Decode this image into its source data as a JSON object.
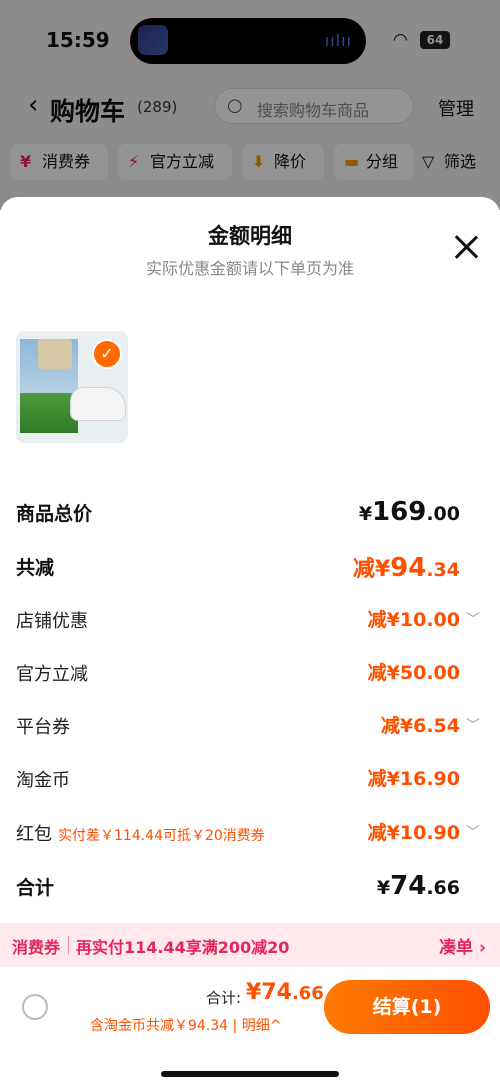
{
  "status_bar": {
    "time": "15:59",
    "battery": "64"
  },
  "nav": {
    "title": "购物车",
    "count": "(289)",
    "search_placeholder": "搜索购物车商品",
    "manage": "管理"
  },
  "filters": [
    {
      "icon": "¥",
      "label": "消费券"
    },
    {
      "icon": "⚡",
      "label": "官方立减"
    },
    {
      "icon": "⬇",
      "label": "降价"
    },
    {
      "icon": "▬",
      "label": "分组"
    },
    {
      "icon": "▽",
      "label": "筛选"
    }
  ],
  "sheet": {
    "title": "金额明细",
    "subtitle": "实际优惠金额请以下单页为准",
    "rows": {
      "goods_total": {
        "label": "商品总价",
        "symbol": "¥",
        "int": "169",
        "dec": ".00"
      },
      "total_reduce": {
        "label": "共减",
        "prefix": "减¥",
        "int": "94",
        "dec": ".34"
      },
      "shop_discount": {
        "label": "店铺优惠",
        "value": "减¥10.00"
      },
      "official_reduce": {
        "label": "官方立减",
        "value": "减¥50.00"
      },
      "platform_coupon": {
        "label": "平台券",
        "value": "减¥6.54"
      },
      "taojin_coin": {
        "label": "淘金币",
        "value": "减¥16.90"
      },
      "red_packet": {
        "label": "红包",
        "note": "实付差￥114.44可抵￥20消费券",
        "value": "减¥10.90"
      },
      "sum": {
        "label": "合计",
        "symbol": "¥",
        "int": "74",
        "dec": ".66"
      }
    }
  },
  "promo": {
    "tag": "消费券",
    "text": "再实付114.44享满200减20",
    "link": "凑单 ›"
  },
  "bottom": {
    "total_label": "合计:",
    "total_symbol": "¥",
    "total_int": "74",
    "total_dec": ".66",
    "total_sub": "含淘金币共减￥94.34 | 明细^",
    "pay_label": "结算(1)"
  },
  "colors": {
    "accent": "#ff5000",
    "promo": "#e6265b"
  }
}
